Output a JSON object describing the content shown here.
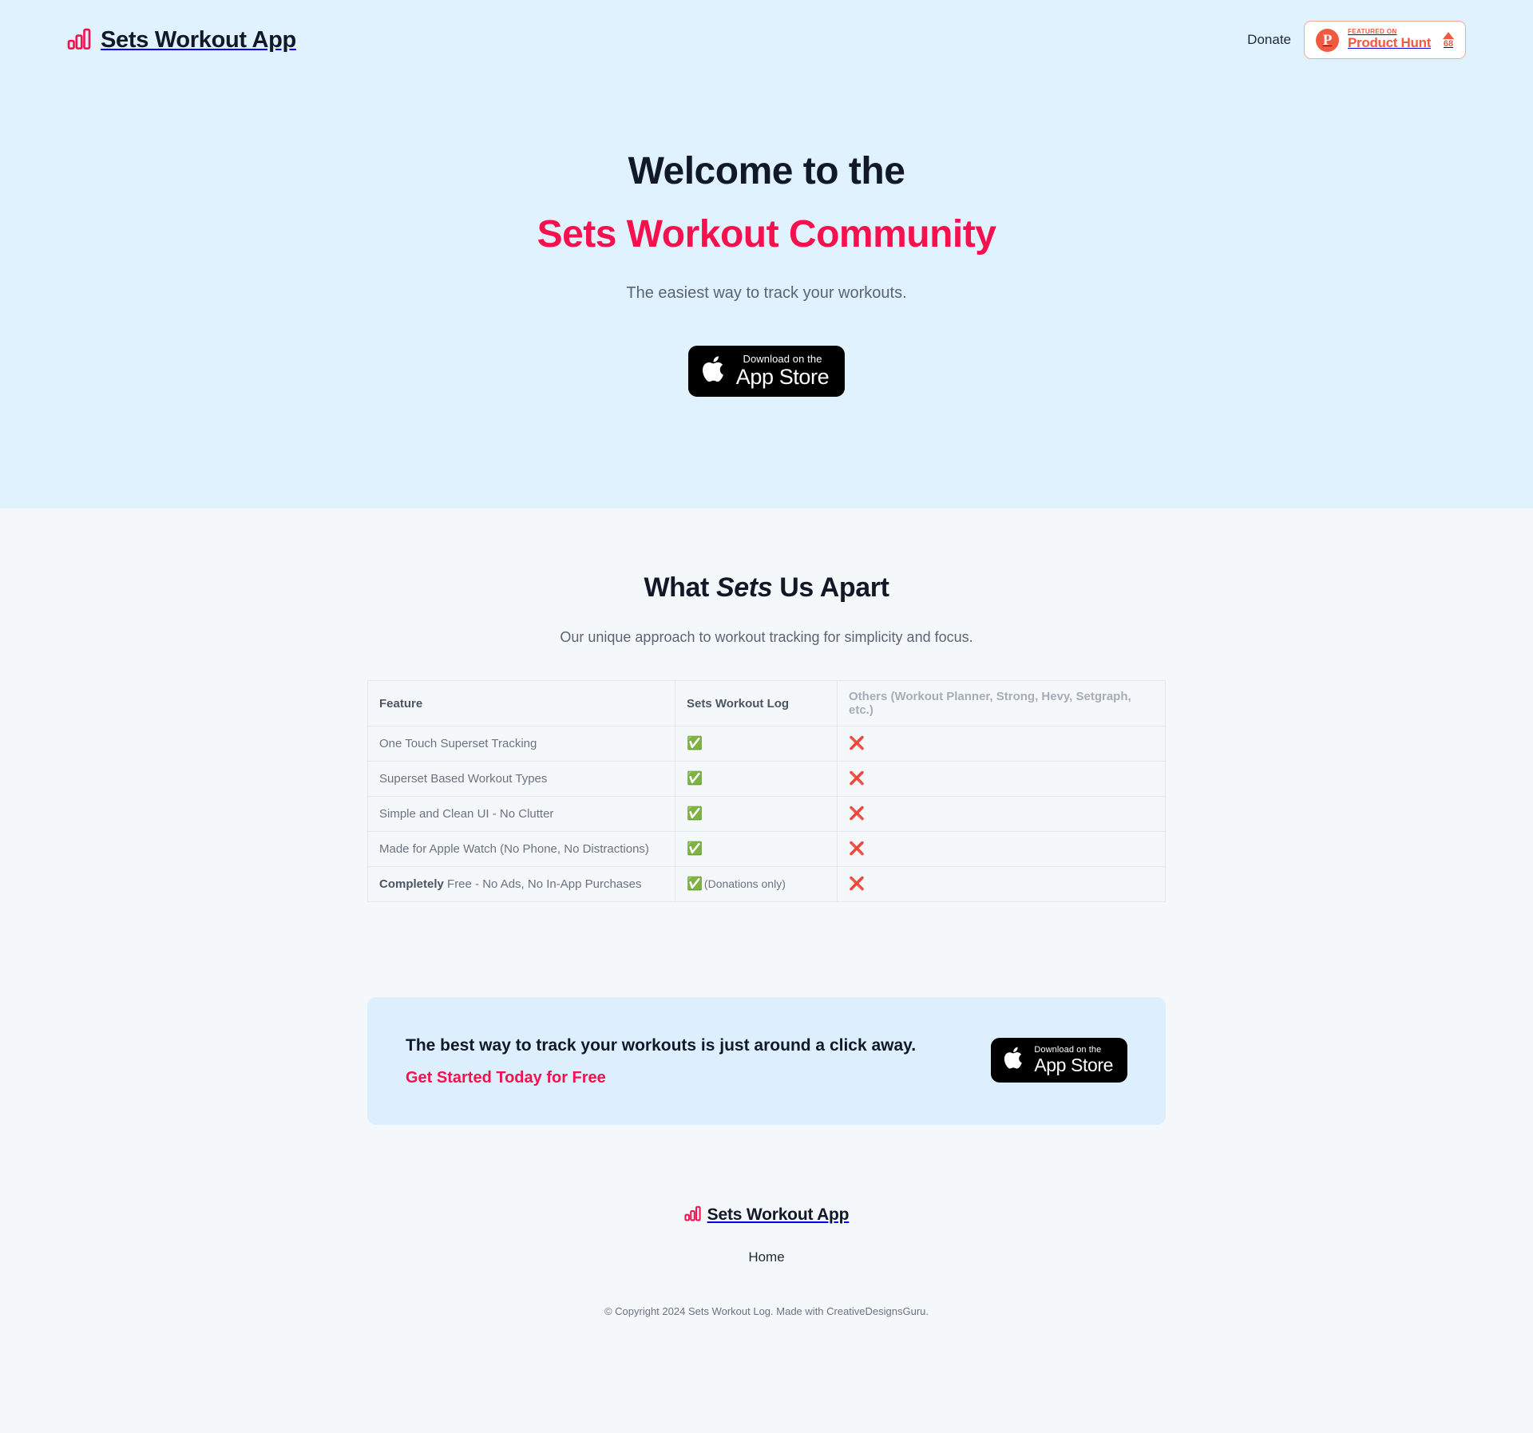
{
  "header": {
    "brand": "Sets Workout App",
    "logo_icon": "bar-chart-icon",
    "donate_label": "Donate",
    "product_hunt": {
      "icon": "product-hunt-p-icon",
      "featured_label": "FEATURED ON",
      "name": "Product Hunt",
      "upvote_icon": "upvote-triangle-icon",
      "count": "68"
    }
  },
  "hero": {
    "title_line1": "Welcome to the",
    "title_line2": "Sets Workout Community",
    "subtitle": "The easiest way to track your workouts.",
    "app_store": {
      "icon": "apple-logo-icon",
      "small": "Download on the",
      "large": "App Store"
    }
  },
  "features": {
    "title_prefix": "What ",
    "title_italic": "Sets",
    "title_suffix": " Us Apart",
    "subtitle": "Our unique approach to workout tracking for simplicity and focus.",
    "table": {
      "headers": [
        "Feature",
        "Sets Workout Log",
        "Others (Workout Planner, Strong, Hevy, Setgraph, etc.)"
      ],
      "rows": [
        {
          "feature_bold": "",
          "feature": "One Touch Superset Tracking",
          "ours_mark": "✅",
          "ours_note": "",
          "others_mark": "❌"
        },
        {
          "feature_bold": "",
          "feature": "Superset Based Workout Types",
          "ours_mark": "✅",
          "ours_note": "",
          "others_mark": "❌"
        },
        {
          "feature_bold": "",
          "feature": "Simple and Clean UI - No Clutter",
          "ours_mark": "✅",
          "ours_note": "",
          "others_mark": "❌"
        },
        {
          "feature_bold": "",
          "feature": "Made for Apple Watch (No Phone, No Distractions)",
          "ours_mark": "✅",
          "ours_note": "",
          "others_mark": "❌"
        },
        {
          "feature_bold": "Completely",
          "feature": " Free - No Ads, No In-App Purchases",
          "ours_mark": "✅",
          "ours_note": "(Donations only)",
          "others_mark": "❌"
        }
      ]
    }
  },
  "cta": {
    "headline": "The best way to track your workouts is just around a click away.",
    "subline": "Get Started Today for Free",
    "app_store": {
      "icon": "apple-logo-icon",
      "small": "Download on the",
      "large": "App Store"
    }
  },
  "footer": {
    "brand": "Sets Workout App",
    "logo_icon": "bar-chart-icon",
    "home_label": "Home",
    "copyright": "© Copyright 2024 Sets Workout Log. Made with CreativeDesignsGuru."
  },
  "colors": {
    "accent_pink": "#f5114e",
    "product_hunt_red": "#f05a40",
    "hero_bg": "#e0f2fd",
    "page_bg": "#f5f8fb",
    "cta_bg": "#ddeffc"
  }
}
